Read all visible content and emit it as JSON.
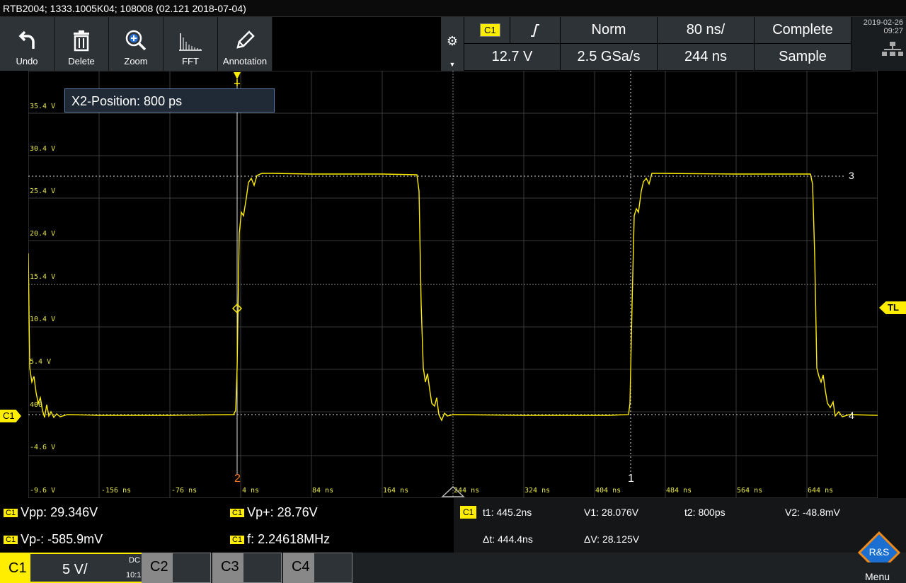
{
  "title": "RTB2004; 1333.1005K04; 108008 (02.121 2018-07-04)",
  "toolbar": {
    "undo": "Undo",
    "delete": "Delete",
    "zoom": "Zoom",
    "fft": "FFT",
    "annotation": "Annotation"
  },
  "status": {
    "channel": "C1",
    "trigger_level": "12.7 V",
    "trigger_mode": "Norm",
    "sample_rate": "2.5 GSa/s",
    "timebase": "80 ns/",
    "position": "244 ns",
    "acq_state": "Complete",
    "acq_mode": "Sample",
    "date": "2019-02-26",
    "time": "09:27"
  },
  "tooltip": "X2-Position: 800 ps",
  "y_labels": [
    "35.4 V",
    "30.4 V",
    "25.4 V",
    "20.4 V",
    "15.4 V",
    "10.4 V",
    "5.4 V",
    "400",
    "-4.6 V",
    "-9.6 V"
  ],
  "x_labels": [
    "-156 ns",
    "-76 ns",
    "4 ns",
    "84 ns",
    "164 ns",
    "244 ns",
    "324 ns",
    "404 ns",
    "484 ns",
    "564 ns",
    "644 ns"
  ],
  "markers": {
    "channel_marker": "C1",
    "trigger_marker": "TL",
    "cursor1": "1",
    "cursor2": "2",
    "cursor3": "3",
    "cursor4": "4"
  },
  "measurements": {
    "vpp": "Vpp: 29.346V",
    "vpp_plus": "Vp+: 28.76V",
    "vpp_minus": "Vp-: -585.9mV",
    "freq": "f: 2.24618MHz",
    "badge": "C1"
  },
  "cursors": {
    "badge": "C1",
    "t1": "t1: 445.2ns",
    "v1": "V1: 28.076V",
    "t2": "t2: 800ps",
    "v2": "V2: -48.8mV",
    "dt": "Δt: 444.4ns",
    "dv": "ΔV: 28.125V"
  },
  "channels": {
    "c1": "C1",
    "c1_scale": "5 V/",
    "c1_coupling": "DC",
    "c1_probe": "10:1",
    "c2": "C2",
    "c3": "C3",
    "c4": "C4"
  },
  "menu_label": "Menu",
  "colors": {
    "trace": "#ffee00",
    "panel": "#2e3338",
    "cursor2": "#ff7a1a"
  }
}
